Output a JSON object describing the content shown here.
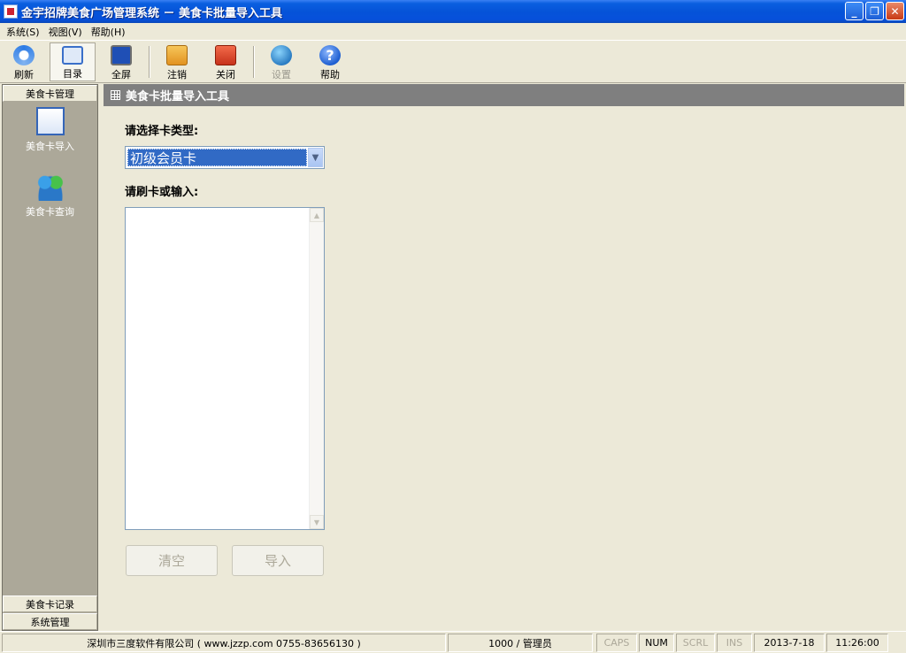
{
  "window": {
    "title": "金宇招牌美食广场管理系统 － 美食卡批量导入工具",
    "controls": {
      "minimize": "_",
      "restore": "❐",
      "close": "✕"
    }
  },
  "menu": [
    {
      "label": "系统(S)"
    },
    {
      "label": "视图(V)"
    },
    {
      "label": "帮助(H)"
    }
  ],
  "toolbar": {
    "refresh": {
      "label": "刷新",
      "icon": "refresh-icon"
    },
    "directory": {
      "label": "目录",
      "icon": "directory-icon"
    },
    "fullscreen": {
      "label": "全屏",
      "icon": "fullscreen-icon"
    },
    "logout": {
      "label": "注销",
      "icon": "key-icon"
    },
    "close": {
      "label": "关闭",
      "icon": "power-icon"
    },
    "settings": {
      "label": "设置",
      "icon": "globe-icon"
    },
    "help": {
      "label": "帮助",
      "icon": "help-icon",
      "glyph": "?"
    }
  },
  "sidebar": {
    "group_title": "美食卡管理",
    "items": [
      {
        "label": "美食卡导入",
        "icon": "card-import-icon"
      },
      {
        "label": "美食卡查询",
        "icon": "users-icon"
      }
    ],
    "bottom_groups": [
      {
        "label": "美食卡记录"
      },
      {
        "label": "系统管理"
      }
    ]
  },
  "panel": {
    "title": "美食卡批量导入工具",
    "card_type_label": "请选择卡类型:",
    "card_type_value": "初级会员卡",
    "input_label": "请刷卡或输入:",
    "input_value": "",
    "clear_button": "清空",
    "import_button": "导入"
  },
  "status": {
    "company": "深圳市三度软件有限公司 ( www.jzzp.com  0755-83656130 )",
    "user": "1000 / 管理员",
    "caps": "CAPS",
    "num": "NUM",
    "scrl": "SCRL",
    "ins": "INS",
    "date": "2013-7-18",
    "time": "11:26:00"
  },
  "colors": {
    "titlebar": "#0553d8",
    "panel_header": "#7f7f7f",
    "sidebar": "#aca899",
    "selection": "#316ac5"
  }
}
